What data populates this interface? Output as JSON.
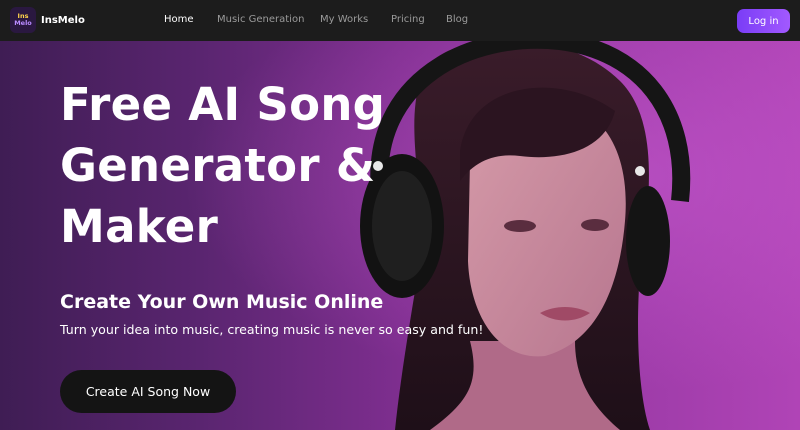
{
  "brand": {
    "logo_line1": "Ins",
    "logo_line2": "Melo",
    "name": "InsMelo"
  },
  "nav": {
    "items": [
      {
        "label": "Home",
        "active": true
      },
      {
        "label": "Music Generation",
        "active": false
      },
      {
        "label": "My Works",
        "active": false
      },
      {
        "label": "Pricing",
        "active": false
      },
      {
        "label": "Blog",
        "active": false
      }
    ],
    "login_label": "Log in"
  },
  "hero": {
    "headline_line1": "Free AI Song",
    "headline_line2": "Generator &",
    "headline_line3": "Maker",
    "subtitle": "Create Your Own Music Online",
    "description": "Turn your idea into music, creating music is never so easy and fun!",
    "cta_label": "Create AI Song Now",
    "image_subject": "woman-wearing-headphones"
  },
  "colors": {
    "nav_bg": "#1c1c1c",
    "accent": "#8a4bff",
    "hero_purple": "#7e2e8f",
    "cta_bg": "#141414"
  }
}
